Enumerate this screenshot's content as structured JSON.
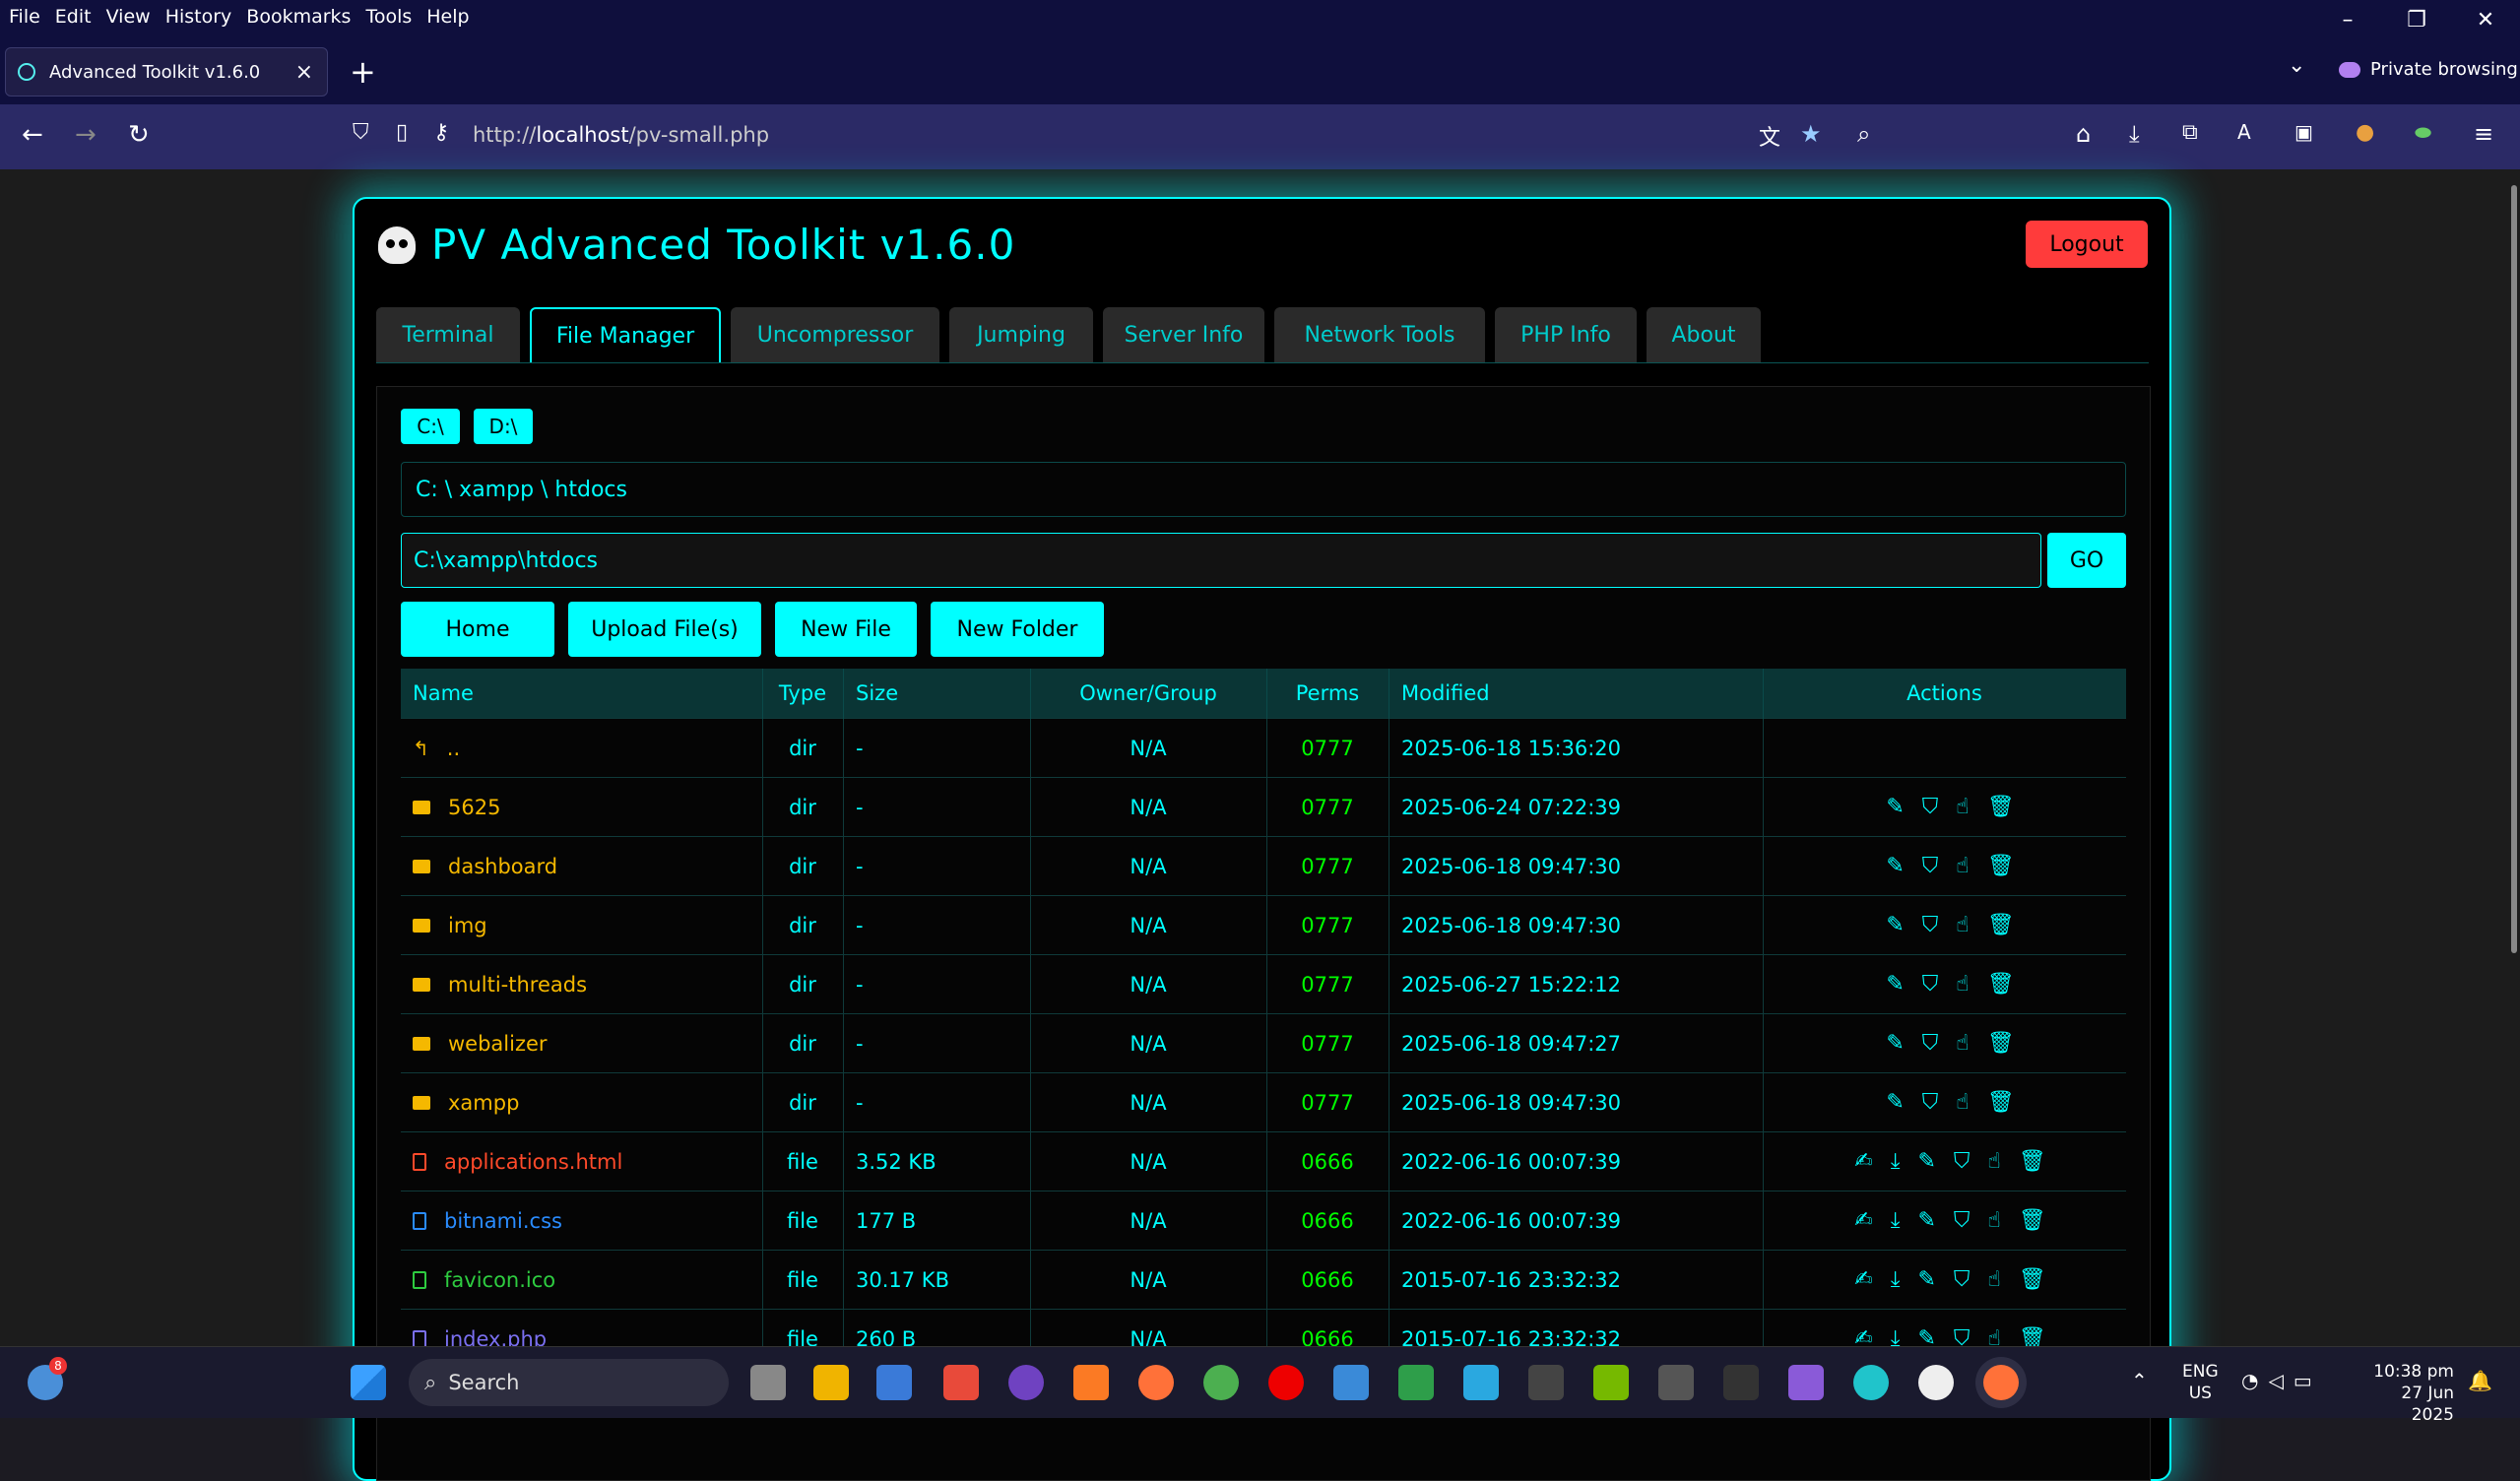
{
  "browser": {
    "menu": [
      "File",
      "Edit",
      "View",
      "History",
      "Bookmarks",
      "Tools",
      "Help"
    ],
    "tab_title": "Advanced Toolkit v1.6.0",
    "private_label": "Private browsing",
    "url_prefix": "http://",
    "url_host": "localhost",
    "url_path": "/pv-small.php"
  },
  "app": {
    "title": "PV Advanced Toolkit v1.6.0",
    "logout": "Logout",
    "tabs": [
      "Terminal",
      "File Manager",
      "Uncompressor",
      "Jumping",
      "Server Info",
      "Network Tools",
      "PHP Info",
      "About"
    ],
    "active_tab": "File Manager",
    "drives": [
      "C:\\",
      "D:\\"
    ],
    "current_path": "C: \\ xampp \\ htdocs",
    "path_input": "C:\\xampp\\htdocs",
    "go": "GO",
    "buttons": [
      "Home",
      "Upload File(s)",
      "New File",
      "New Folder"
    ],
    "columns": [
      "Name",
      "Type",
      "Size",
      "Owner/Group",
      "Perms",
      "Modified",
      "Actions"
    ],
    "rows": [
      {
        "name": "..",
        "type": "dir",
        "size": "-",
        "owner": "N/A",
        "perms": "0777",
        "modified": "2025-06-18 15:36:20",
        "kind": "up",
        "color": "#f5b800"
      },
      {
        "name": "5625",
        "type": "dir",
        "size": "-",
        "owner": "N/A",
        "perms": "0777",
        "modified": "2025-06-24 07:22:39",
        "kind": "dir",
        "color": "#f5b800"
      },
      {
        "name": "dashboard",
        "type": "dir",
        "size": "-",
        "owner": "N/A",
        "perms": "0777",
        "modified": "2025-06-18 09:47:30",
        "kind": "dir",
        "color": "#f5b800"
      },
      {
        "name": "img",
        "type": "dir",
        "size": "-",
        "owner": "N/A",
        "perms": "0777",
        "modified": "2025-06-18 09:47:30",
        "kind": "dir",
        "color": "#f5b800"
      },
      {
        "name": "multi-threads",
        "type": "dir",
        "size": "-",
        "owner": "N/A",
        "perms": "0777",
        "modified": "2025-06-27 15:22:12",
        "kind": "dir",
        "color": "#f5b800"
      },
      {
        "name": "webalizer",
        "type": "dir",
        "size": "-",
        "owner": "N/A",
        "perms": "0777",
        "modified": "2025-06-18 09:47:27",
        "kind": "dir",
        "color": "#f5b800"
      },
      {
        "name": "xampp",
        "type": "dir",
        "size": "-",
        "owner": "N/A",
        "perms": "0777",
        "modified": "2025-06-18 09:47:30",
        "kind": "dir",
        "color": "#f5b800"
      },
      {
        "name": "applications.html",
        "type": "file",
        "size": "3.52 KB",
        "owner": "N/A",
        "perms": "0666",
        "modified": "2022-06-16 00:07:39",
        "kind": "file",
        "color": "#ff4a2a"
      },
      {
        "name": "bitnami.css",
        "type": "file",
        "size": "177 B",
        "owner": "N/A",
        "perms": "0666",
        "modified": "2022-06-16 00:07:39",
        "kind": "file",
        "color": "#2a8cff"
      },
      {
        "name": "favicon.ico",
        "type": "file",
        "size": "30.17 KB",
        "owner": "N/A",
        "perms": "0666",
        "modified": "2015-07-16 23:32:32",
        "kind": "file",
        "color": "#2ecc40"
      },
      {
        "name": "index.php",
        "type": "file",
        "size": "260 B",
        "owner": "N/A",
        "perms": "0666",
        "modified": "2015-07-16 23:32:32",
        "kind": "file",
        "color": "#7a6ff0"
      }
    ]
  },
  "taskbar": {
    "search": "Search",
    "weather_badge": "8",
    "lang1": "ENG",
    "lang2": "US",
    "time": "10:38 pm",
    "date": "27 Jun 2025"
  }
}
